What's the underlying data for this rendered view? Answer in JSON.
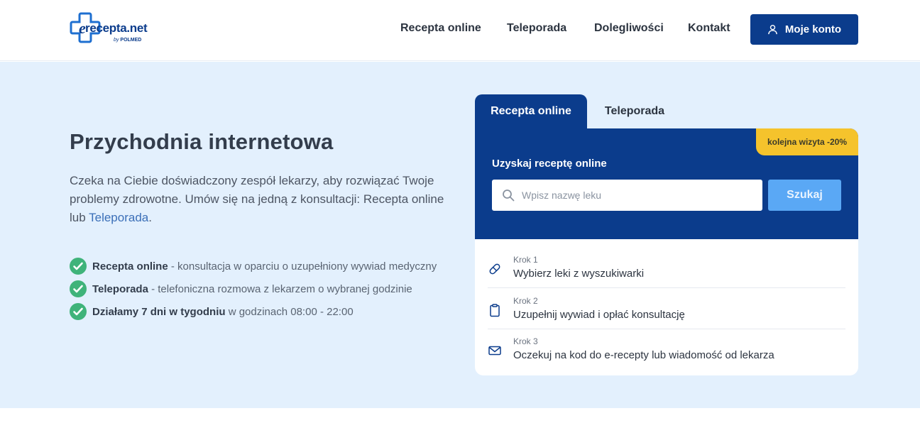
{
  "header": {
    "logo_text": "recepta.net",
    "logo_by": "by",
    "logo_brand": "POLMED",
    "nav": [
      "Recepta online",
      "Teleporada",
      "Dolegliwości",
      "Kontakt"
    ],
    "account_button": "Moje konto"
  },
  "hero": {
    "title": "Przychodnia internetowa",
    "description_before": "Czeka na Ciebie doświadczony zespół lekarzy, aby rozwiązać Twoje problemy zdrowotne. Umów się na jedną z konsultacji: Recepta online lub ",
    "description_link": "Teleporada",
    "description_after": ".",
    "features": [
      {
        "bold": "Recepta online",
        "text": " - konsultacja w oparciu o uzupełniony wywiad medyczny"
      },
      {
        "bold": "Teleporada",
        "text": " - telefoniczna rozmowa z lekarzem o wybranej godzinie"
      },
      {
        "bold": "Działamy 7 dni w tygodniu",
        "text": " w godzinach 08:00 - 22:00"
      }
    ]
  },
  "card": {
    "tabs": [
      "Recepta online",
      "Teleporada"
    ],
    "discount_badge": "kolejna wizyta -20%",
    "label": "Uzyskaj receptę online",
    "search_placeholder": "Wpisz nazwę leku",
    "search_button": "Szukaj",
    "steps": [
      {
        "number": "Krok 1",
        "text": "Wybierz leki z wyszukiwarki",
        "icon": "pill-icon"
      },
      {
        "number": "Krok 2",
        "text": "Uzupełnij wywiad i opłać konsultację",
        "icon": "clipboard-icon"
      },
      {
        "number": "Krok 3",
        "text": "Oczekuj na kod do e-recepty lub wiadomość od lekarza",
        "icon": "mail-icon"
      }
    ]
  },
  "colors": {
    "brand": "#0b3c8c",
    "hero_bg": "#e3f0fd",
    "badge": "#f5c32c",
    "search_button": "#5aa8f5",
    "check": "#3fb37a"
  }
}
